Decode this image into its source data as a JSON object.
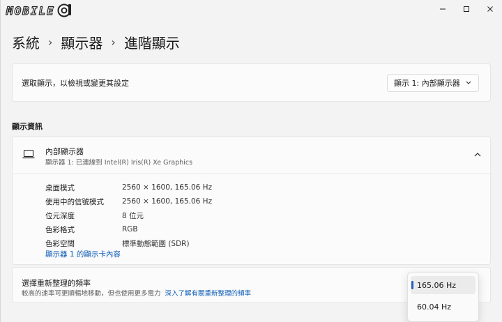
{
  "watermark": {
    "text": "MOBILE"
  },
  "window_controls": {
    "minimize": "—",
    "maximize": "☐",
    "close": "✕"
  },
  "breadcrumb": {
    "items": [
      "系統",
      "顯示器",
      "進階顯示"
    ],
    "separator": "›"
  },
  "select_display": {
    "label": "選取顯示，以檢視或變更其設定",
    "dropdown_value": "顯示 1: 內部顯示器"
  },
  "display_info": {
    "heading": "顯示資訊",
    "name": "內部顯示器",
    "subtitle": "顯示器 1: 已連線到 Intel(R) Iris(R) Xe Graphics",
    "rows": [
      {
        "label": "桌面模式",
        "value": "2560 × 1600, 165.06 Hz"
      },
      {
        "label": "使用中的信號模式",
        "value": "2560 × 1600, 165.06 Hz"
      },
      {
        "label": "位元深度",
        "value": "8 位元"
      },
      {
        "label": "色彩格式",
        "value": "RGB"
      },
      {
        "label": "色彩空間",
        "value": "標準動態範圍 (SDR)"
      }
    ],
    "adapter_link": "顯示器 1 的顯示卡內容"
  },
  "refresh_rate": {
    "title": "選擇重新整理的頻率",
    "subtitle": "較高的速率可更順暢地移動，但也使用更多電力",
    "learn_more": "深入了解有關重新整理的頻率",
    "options": [
      "165.06 Hz",
      "60.04 Hz"
    ],
    "selected": "165.06 Hz"
  },
  "colors": {
    "accent": "#1f5fbf",
    "link": "#0b5bb5",
    "background": "#f3f3f3",
    "card": "#fbfbfb"
  }
}
